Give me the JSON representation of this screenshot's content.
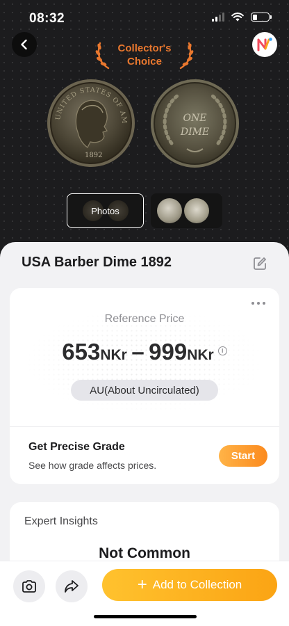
{
  "status_bar": {
    "time": "08:32"
  },
  "hero": {
    "badge_line1": "Collector's",
    "badge_line2": "Choice",
    "obverse_legend": "UNITED STATES OF AMERICA",
    "obverse_year": "1892",
    "reverse_line1": "ONE",
    "reverse_line2": "DIME",
    "photos_label": "Photos"
  },
  "coin": {
    "title": "USA Barber Dime 1892"
  },
  "price_card": {
    "label": "Reference Price",
    "low": "653",
    "high": "999",
    "currency": "NKr",
    "separator": "–",
    "grade": "AU(About Uncirculated)",
    "grade_title": "Get Precise Grade",
    "grade_subtitle": "See how grade affects prices.",
    "start_label": "Start"
  },
  "insights": {
    "label": "Expert Insights",
    "value": "Not Common"
  },
  "actions": {
    "add_label": "Add to Collection"
  },
  "colors": {
    "accent_orange": "#e8772e",
    "button_yellow": "#fba414",
    "start_orange": "#fb8a1e"
  }
}
